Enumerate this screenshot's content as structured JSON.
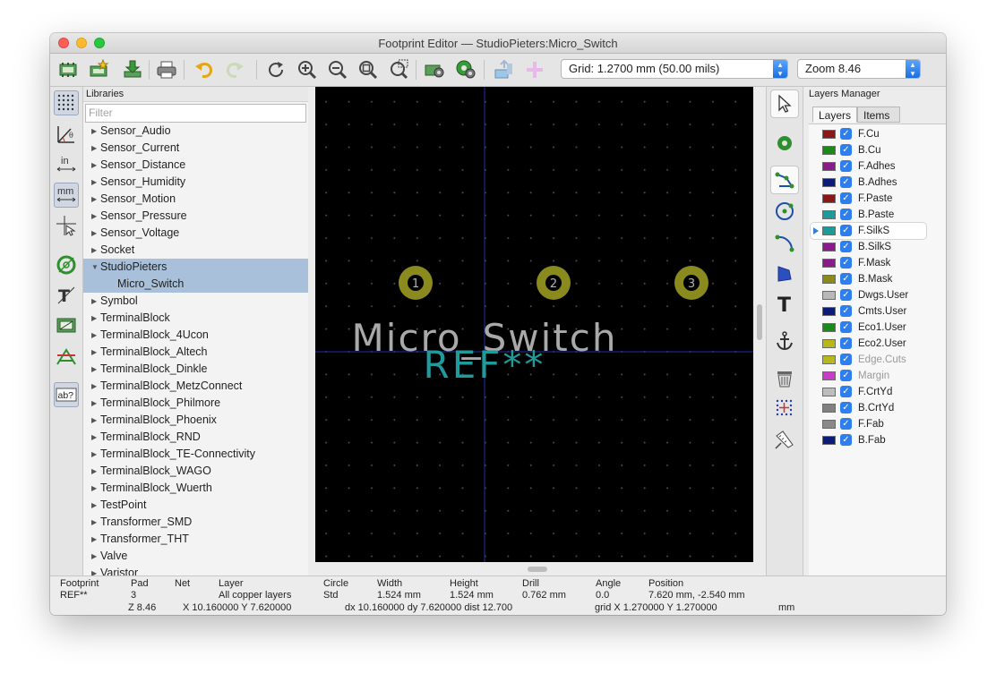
{
  "window": {
    "title": "Footprint Editor — StudioPieters:Micro_Switch"
  },
  "toolbar": {
    "grid_label": "Grid: 1.2700 mm (50.00 mils)",
    "zoom_label": "Zoom 8.46",
    "icons": [
      "new-footprint-icon",
      "new-footprint-wizard-icon",
      "load-footprint-icon",
      "print-icon",
      "undo-icon",
      "redo-icon",
      "redraw-icon",
      "zoom-in-icon",
      "zoom-out-icon",
      "zoom-fit-icon",
      "zoom-selection-icon",
      "footprint-properties-icon",
      "pad-settings-icon",
      "insert-footprint-icon",
      "check-footprint-icon"
    ]
  },
  "left_toolbar": {
    "icons": [
      "grid-icon",
      "polar-coords-icon",
      "inch-units-icon",
      "mm-units-icon",
      "cursor-crosshair-icon",
      "pad-sketch-icon",
      "text-sketch-icon",
      "graphic-sketch-icon",
      "ratsnest-icon",
      "show-text-icon"
    ],
    "in_label": "in",
    "mm_label": "mm",
    "ab_label": "ab?"
  },
  "libraries": {
    "header": "Libraries",
    "filter_placeholder": "Filter",
    "items": [
      {
        "label": "Sensor_Audio",
        "state": "collapsed"
      },
      {
        "label": "Sensor_Current",
        "state": "collapsed"
      },
      {
        "label": "Sensor_Distance",
        "state": "collapsed"
      },
      {
        "label": "Sensor_Humidity",
        "state": "collapsed"
      },
      {
        "label": "Sensor_Motion",
        "state": "collapsed"
      },
      {
        "label": "Sensor_Pressure",
        "state": "collapsed"
      },
      {
        "label": "Sensor_Voltage",
        "state": "collapsed"
      },
      {
        "label": "Socket",
        "state": "collapsed"
      },
      {
        "label": "StudioPieters",
        "state": "expanded"
      },
      {
        "label": "Micro_Switch",
        "state": "child-selected"
      },
      {
        "label": "Symbol",
        "state": "collapsed"
      },
      {
        "label": "TerminalBlock",
        "state": "collapsed"
      },
      {
        "label": "TerminalBlock_4Ucon",
        "state": "collapsed"
      },
      {
        "label": "TerminalBlock_Altech",
        "state": "collapsed"
      },
      {
        "label": "TerminalBlock_Dinkle",
        "state": "collapsed"
      },
      {
        "label": "TerminalBlock_MetzConnect",
        "state": "collapsed"
      },
      {
        "label": "TerminalBlock_Philmore",
        "state": "collapsed"
      },
      {
        "label": "TerminalBlock_Phoenix",
        "state": "collapsed"
      },
      {
        "label": "TerminalBlock_RND",
        "state": "collapsed"
      },
      {
        "label": "TerminalBlock_TE-Connectivity",
        "state": "collapsed"
      },
      {
        "label": "TerminalBlock_WAGO",
        "state": "collapsed"
      },
      {
        "label": "TerminalBlock_Wuerth",
        "state": "collapsed"
      },
      {
        "label": "TestPoint",
        "state": "collapsed"
      },
      {
        "label": "Transformer_SMD",
        "state": "collapsed"
      },
      {
        "label": "Transformer_THT",
        "state": "collapsed"
      },
      {
        "label": "Valve",
        "state": "collapsed"
      },
      {
        "label": "Varistor",
        "state": "collapsed"
      }
    ]
  },
  "canvas": {
    "pads": [
      "1",
      "2",
      "3"
    ],
    "value_text": "Micro_Switch",
    "ref_text": "REF**",
    "colors": {
      "background": "#000000",
      "pad": "#8a8a1e",
      "value": "#a9a9a9",
      "ref": "#1f9b9b",
      "axis": "#1c2fa8"
    }
  },
  "right_toolbar": {
    "icons": [
      "select-arrow-icon",
      "add-pad-icon",
      "add-line-icon",
      "add-circle-icon",
      "add-arc-icon",
      "add-polygon-icon",
      "add-text-icon",
      "anchor-icon",
      "delete-icon",
      "grid-origin-icon",
      "measure-icon"
    ],
    "text_glyph": "T"
  },
  "layers_manager": {
    "header": "Layers Manager",
    "tabs": [
      "Layers",
      "Items"
    ],
    "layers": [
      {
        "name": "F.Cu",
        "color": "#8a1818",
        "enabled": true
      },
      {
        "name": "B.Cu",
        "color": "#1b8a1b",
        "enabled": true
      },
      {
        "name": "F.Adhes",
        "color": "#8a1b8a",
        "enabled": true
      },
      {
        "name": "B.Adhes",
        "color": "#0b1b7a",
        "enabled": true
      },
      {
        "name": "F.Paste",
        "color": "#8a1818",
        "enabled": true
      },
      {
        "name": "B.Paste",
        "color": "#1b9a9a",
        "enabled": true
      },
      {
        "name": "F.SilkS",
        "color": "#1b9a9a",
        "enabled": true,
        "selected": true
      },
      {
        "name": "B.SilkS",
        "color": "#8a1b8a",
        "enabled": true
      },
      {
        "name": "F.Mask",
        "color": "#8a1b8a",
        "enabled": true
      },
      {
        "name": "B.Mask",
        "color": "#8a8a1b",
        "enabled": true
      },
      {
        "name": "Dwgs.User",
        "color": "#b8b8b8",
        "enabled": true
      },
      {
        "name": "Cmts.User",
        "color": "#0b1b7a",
        "enabled": true
      },
      {
        "name": "Eco1.User",
        "color": "#1b8a1b",
        "enabled": true
      },
      {
        "name": "Eco2.User",
        "color": "#b8b81b",
        "enabled": true
      },
      {
        "name": "Edge.Cuts",
        "color": "#b8b81b",
        "enabled": true,
        "disabled_text": true
      },
      {
        "name": "Margin",
        "color": "#c83cc8",
        "enabled": true,
        "disabled_text": true
      },
      {
        "name": "F.CrtYd",
        "color": "#bdbdbd",
        "enabled": true
      },
      {
        "name": "B.CrtYd",
        "color": "#808080",
        "enabled": true
      },
      {
        "name": "F.Fab",
        "color": "#8a8a8a",
        "enabled": true
      },
      {
        "name": "B.Fab",
        "color": "#0b1b7a",
        "enabled": true
      }
    ]
  },
  "status": {
    "h_footprint": "Footprint",
    "v_footprint": "REF**",
    "h_pad": "Pad",
    "v_pad": "3",
    "h_net": "Net",
    "h_layer": "Layer",
    "v_layer": "All copper layers",
    "h_circle": "Circle",
    "v_circle": "Std",
    "h_width": "Width",
    "v_width": "1.524 mm",
    "h_height": "Height",
    "v_height": "1.524 mm",
    "h_drill": "Drill",
    "v_drill": "0.762 mm",
    "h_angle": "Angle",
    "v_angle": "0.0",
    "h_position": "Position",
    "v_position": "7.620 mm, -2.540 mm",
    "zoom": "Z 8.46",
    "cursor": "X 10.160000  Y 7.620000",
    "delta": "dx 10.160000  dy 7.620000  dist 12.700",
    "grid": "grid X 1.270000  Y 1.270000",
    "units": "mm"
  }
}
